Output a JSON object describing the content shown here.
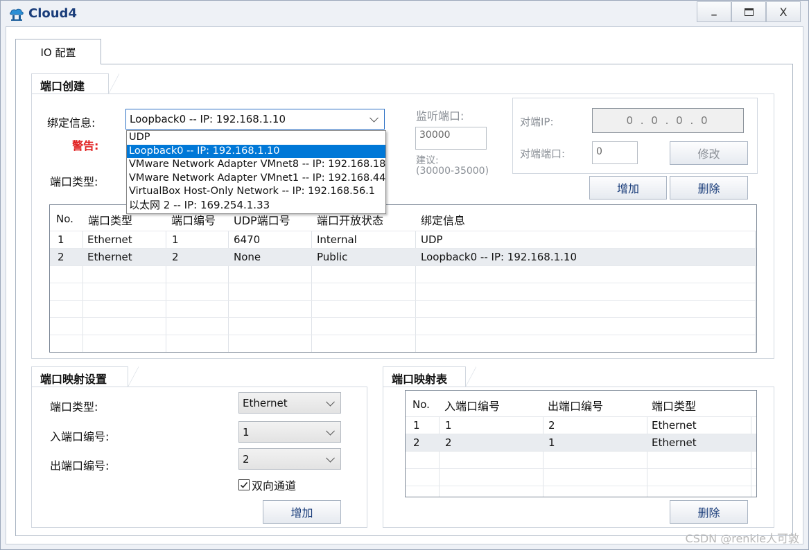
{
  "window": {
    "title": "Cloud4",
    "minimize": "_",
    "maximize": "□",
    "close": "X"
  },
  "tabs": [
    {
      "label": "IO 配置"
    }
  ],
  "port_create": {
    "section_title": "端口创建",
    "bind_label": "绑定信息:",
    "bind_value": "Loopback0 -- IP: 192.168.1.10",
    "warning_label": "警告:",
    "port_type_label": "端口类型:",
    "dropdown_options": [
      "UDP",
      "Loopback0 -- IP: 192.168.1.10",
      "VMware Network Adapter VMnet8 -- IP: 192.168.18",
      "VMware Network Adapter VMnet1 -- IP: 192.168.44",
      "VirtualBox Host-Only Network -- IP: 192.168.56.1",
      "以太网 2 -- IP: 169.254.1.33"
    ],
    "dropdown_selected_index": 1,
    "listen_port_label": "监听端口:",
    "listen_port_value": "30000",
    "suggest_label": "建议:",
    "suggest_range": "(30000-35000)",
    "peer_ip_label": "对端IP:",
    "peer_ip_value": "0 . 0 . 0 . 0",
    "peer_port_label": "对端端口:",
    "peer_port_value": "0",
    "modify_button": "修改",
    "add_button": "增加",
    "delete_button": "删除"
  },
  "port_table": {
    "headers": [
      "No.",
      "端口类型",
      "端口编号",
      "UDP端口号",
      "端口开放状态",
      "绑定信息"
    ],
    "rows": [
      [
        "1",
        "Ethernet",
        "1",
        "6470",
        "Internal",
        "UDP"
      ],
      [
        "2",
        "Ethernet",
        "2",
        "None",
        "Public",
        "Loopback0 -- IP: 192.168.1.10"
      ]
    ]
  },
  "mapping_settings": {
    "section_title": "端口映射设置",
    "port_type_label": "端口类型:",
    "port_type_value": "Ethernet",
    "in_port_label": "入端口编号:",
    "in_port_value": "1",
    "out_port_label": "出端口编号:",
    "out_port_value": "2",
    "bidirectional_label": "双向通道",
    "bidirectional_checked": true,
    "add_button": "增加"
  },
  "mapping_table": {
    "section_title": "端口映射表",
    "headers": [
      "No.",
      "入端口编号",
      "出端口编号",
      "端口类型"
    ],
    "rows": [
      [
        "1",
        "1",
        "2",
        "Ethernet"
      ],
      [
        "2",
        "2",
        "1",
        "Ethernet"
      ]
    ],
    "delete_button": "删除"
  },
  "watermark": "CSDN @renkie人可敦",
  "colors": {
    "title": "#1a3d7a",
    "warning": "#e02020",
    "selection": "#0078d7"
  }
}
